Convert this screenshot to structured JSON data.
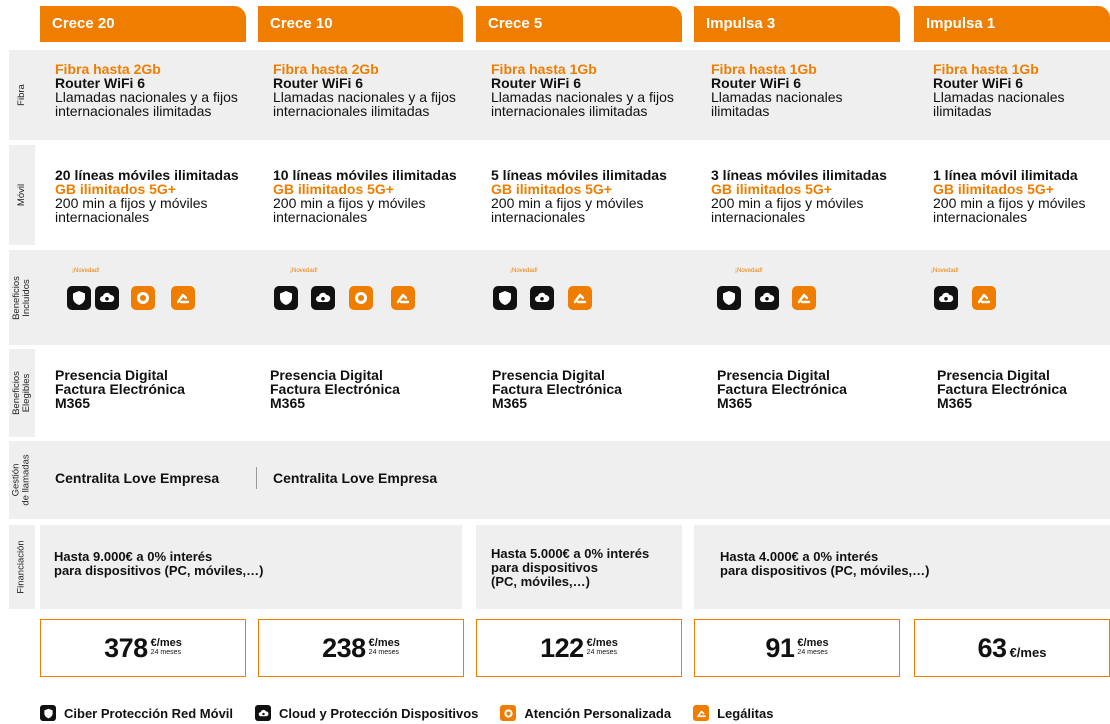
{
  "plans": [
    {
      "name": "Crece 20",
      "fibra": [
        "Fibra hasta 2Gb",
        "Router WiFi 6",
        "Llamadas nacionales y a fijos",
        "internacionales ilimitadas"
      ],
      "movil": [
        "20 líneas móviles ilimitadas",
        "GB ilimitados 5G+",
        "200 min a fijos y móviles",
        "internacionales"
      ],
      "novedad": "¡Novedad!",
      "elegibles": [
        "Presencia Digital",
        "Factura Electrónica",
        "M365"
      ],
      "gestion": "Centralita Love Empresa",
      "price": "378",
      "price_unit": "€/mes",
      "price_term": "24 meses"
    },
    {
      "name": "Crece 10",
      "fibra": [
        "Fibra hasta 2Gb",
        "Router WiFi 6",
        "Llamadas nacionales y a fijos",
        "internacionales ilimitadas"
      ],
      "movil": [
        "10 líneas móviles ilimitadas",
        "GB ilimitados 5G+",
        "200 min a fijos y móviles",
        "internacionales"
      ],
      "novedad": "¡Novedad!",
      "elegibles": [
        "Presencia Digital",
        "Factura Electrónica",
        "M365"
      ],
      "gestion": "Centralita Love Empresa",
      "price": "238",
      "price_unit": "€/mes",
      "price_term": "24 meses"
    },
    {
      "name": "Crece 5",
      "fibra": [
        "Fibra hasta 1Gb",
        "Router WiFi 6",
        "Llamadas nacionales y a fijos",
        "internacionales ilimitadas"
      ],
      "movil": [
        "5 líneas móviles ilimitadas",
        "GB ilimitados 5G+",
        "200 min a fijos y móviles",
        "internacionales"
      ],
      "novedad": "¡Novedad!",
      "elegibles": [
        "Presencia Digital",
        "Factura Electrónica",
        "M365"
      ],
      "price": "122",
      "price_unit": "€/mes",
      "price_term": "24 meses"
    },
    {
      "name": "Impulsa 3",
      "fibra": [
        "Fibra hasta 1Gb",
        "Router WiFi 6",
        "Llamadas nacionales",
        "ilimitadas"
      ],
      "movil": [
        "3 líneas móviles ilimitadas",
        "GB ilimitados 5G+",
        "200 min a fijos y móviles",
        "internacionales"
      ],
      "novedad": "¡Novedad!",
      "elegibles": [
        "Presencia Digital",
        "Factura Electrónica",
        "M365"
      ],
      "price": "91",
      "price_unit": "€/mes",
      "price_term": "24 meses"
    },
    {
      "name": "Impulsa 1",
      "fibra": [
        "Fibra hasta 1Gb",
        "Router WiFi 6",
        "Llamadas nacionales",
        "ilimitadas"
      ],
      "movil": [
        "1 línea móvil ilimitada",
        "GB ilimitados 5G+",
        "200 min a fijos y móviles",
        "internacionales"
      ],
      "novedad": "¡Novedad!",
      "elegibles": [
        "Presencia Digital",
        "Factura Electrónica",
        "M365"
      ],
      "price": "63",
      "price_unit": "€/mes"
    }
  ],
  "row_labels": {
    "fibra": "Fibra",
    "movil": "Móvil",
    "incluidos": [
      "Beneficios",
      "Incluidos"
    ],
    "elegibles": [
      "Beneficios",
      "Elegibles"
    ],
    "gestion": [
      "Gestión",
      "de llamadas"
    ],
    "financiacion": "Financiación"
  },
  "financiacion": [
    [
      "Hasta 9.000€ a 0% interés",
      "para dispositivos (PC, móviles,…)"
    ],
    [
      "Hasta 5.000€ a 0% interés",
      "para dispositivos",
      "(PC, móviles,…)"
    ],
    [
      "Hasta 4.000€ a 0% interés",
      "para dispositivos (PC, móviles,…)"
    ]
  ],
  "legend": [
    {
      "label": "Ciber Protección Red Móvil",
      "icon": "shield-icon",
      "color": "#111111"
    },
    {
      "label": "Cloud y Protección Dispositivos",
      "icon": "cloud-icon",
      "color": "#111111"
    },
    {
      "label": "Atención Personalizada",
      "icon": "headset-icon",
      "color": "#ef7d00"
    },
    {
      "label": "Legálitas",
      "icon": "legal-icon",
      "color": "#ef7d00"
    }
  ],
  "colors": {
    "accent": "#ef7d00",
    "row_gray": "#efefef",
    "icon_dark": "#111111"
  }
}
